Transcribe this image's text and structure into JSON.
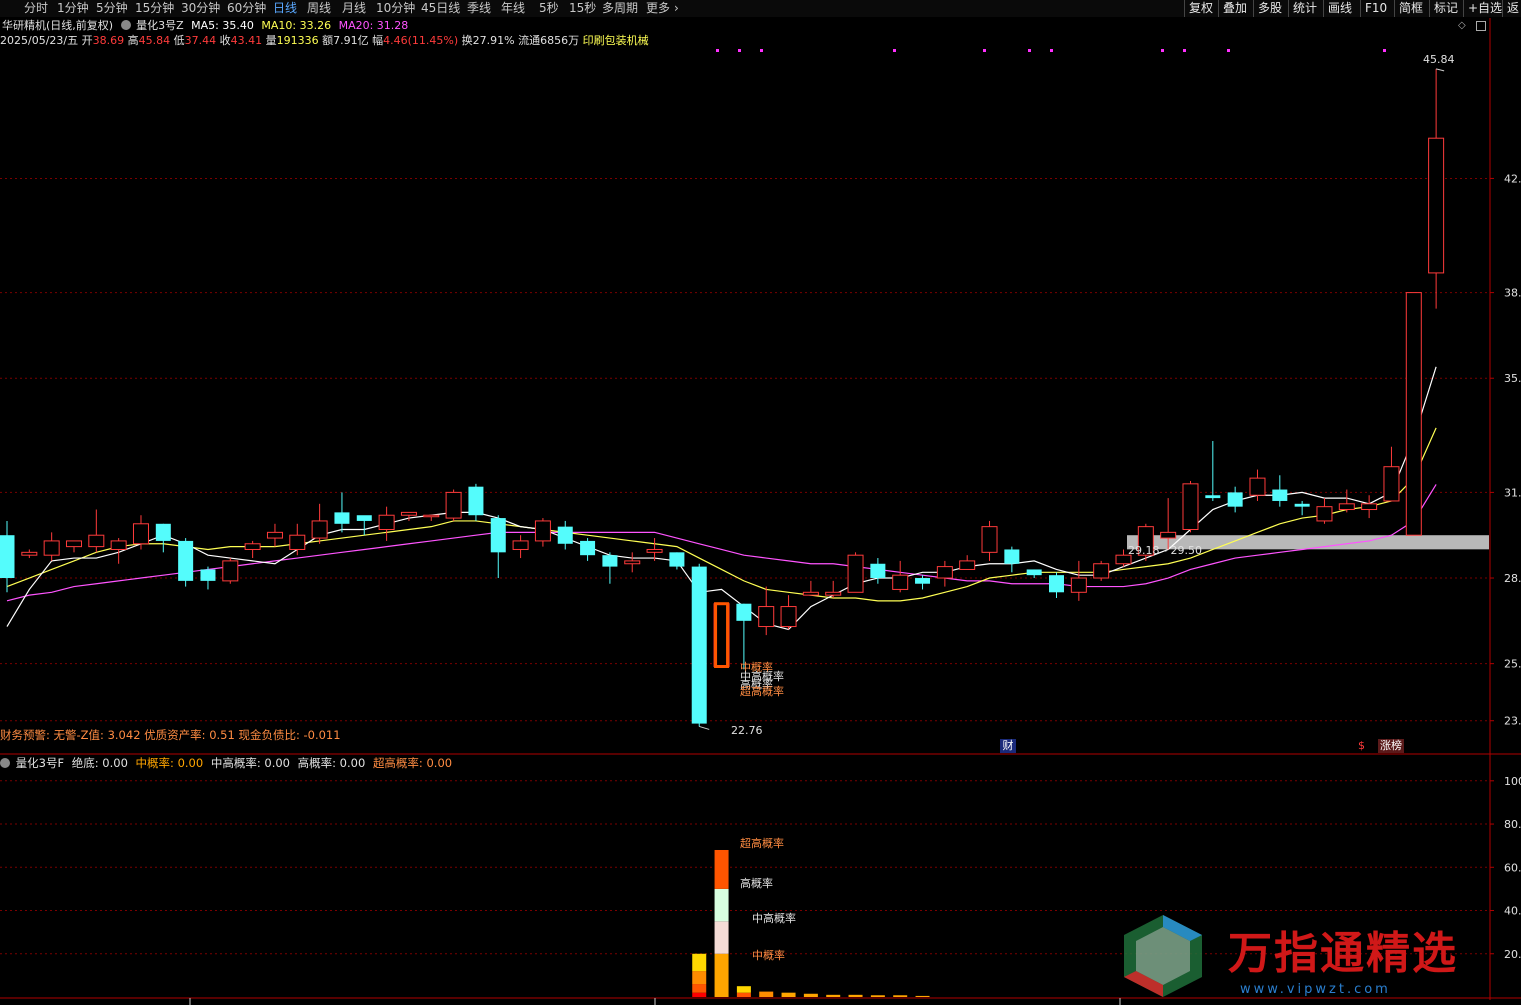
{
  "periods": [
    "分时",
    "1分钟",
    "5分钟",
    "15分钟",
    "30分钟",
    "60分钟",
    "日线",
    "周线",
    "月线",
    "10分钟",
    "45日线",
    "季线",
    "年线",
    "5秒",
    "15秒",
    "多周期",
    "更多"
  ],
  "active_period": "日线",
  "tools": [
    "复权",
    "叠加",
    "多股",
    "统计",
    "画线",
    "F10",
    "简框",
    "标记",
    "+自选",
    "返"
  ],
  "title": "华研精机(日线,前复权)",
  "indicator": "量化3号Z",
  "ma": {
    "ma5_label": "MA5: 35.40",
    "ma10_label": "MA10: 33.26",
    "ma20_label": "MA20: 31.28"
  },
  "info": {
    "date": "2025/05/23/五",
    "open_label": "开",
    "open": "38.69",
    "high_label": "高",
    "high": "45.84",
    "low_label": "低",
    "low": "37.44",
    "close_label": "收",
    "close": "43.41",
    "vol_label": "量",
    "vol": "191336",
    "amt_label": "额",
    "amt": "7.91亿",
    "chg_label": "幅",
    "chg": "4.46(11.45%)",
    "turn": "换27.91%",
    "float": "流通6856万",
    "sector": "印刷包装机械"
  },
  "fin_warning": "财务预警: 无警-Z值: 3.042 优质资产率: 0.51 现金负债比: -0.011",
  "zone_label": "29.18 - 29.50",
  "max_label": "45.84",
  "min_label": "22.76",
  "main_labels": [
    "中概率",
    "中高概率",
    "高概率",
    "超高概率"
  ],
  "price_axis": [
    "42.",
    "38.",
    "35.",
    "31.",
    "28.",
    "25.",
    "23."
  ],
  "badges": {
    "cai": "财",
    "s": "$",
    "zhangting": "涨榜"
  },
  "sub": {
    "title": "量化3号F",
    "jd": "绝底: 0.00",
    "zgl": "中概率: 0.00",
    "zggl": "中高概率: 0.00",
    "ggl": "高概率: 0.00",
    "cggl": "超高概率: 0.00",
    "axis": [
      "100",
      "80.",
      "60.",
      "40.",
      "20."
    ],
    "bar_labels": [
      "超高概率",
      "高概率",
      "中高概率",
      "中概率"
    ]
  },
  "watermark": {
    "text": "万指通精选",
    "url": "www.vipwzt.com"
  },
  "colors": {
    "up": "#ff3b3b",
    "down": "#54fcfc",
    "ma5": "#ffffff",
    "ma10": "#ffff54",
    "ma20": "#ff54ff",
    "grid": "#7a0000",
    "axis": "#b00000"
  },
  "chart_data": {
    "type": "candlestick",
    "y_range": [
      22.5,
      46.5
    ],
    "candles": [
      [
        29.5,
        28.0,
        30.0,
        27.5
      ],
      [
        28.8,
        28.9,
        29.0,
        28.7
      ],
      [
        28.8,
        29.3,
        29.6,
        28.6
      ],
      [
        29.1,
        29.3,
        29.3,
        28.9
      ],
      [
        29.1,
        29.5,
        30.4,
        28.9
      ],
      [
        29.0,
        29.3,
        29.4,
        28.5
      ],
      [
        29.2,
        29.9,
        30.2,
        29.0
      ],
      [
        29.9,
        29.3,
        29.9,
        28.9
      ],
      [
        29.3,
        27.9,
        29.4,
        27.7
      ],
      [
        28.3,
        27.9,
        28.4,
        27.6
      ],
      [
        27.9,
        28.6,
        28.7,
        27.8
      ],
      [
        29.0,
        29.2,
        29.3,
        28.7
      ],
      [
        29.4,
        29.6,
        29.9,
        29.1
      ],
      [
        29.0,
        29.5,
        29.9,
        28.8
      ],
      [
        29.4,
        30.0,
        30.6,
        29.2
      ],
      [
        30.3,
        29.9,
        31.0,
        29.6
      ],
      [
        30.2,
        30.0,
        30.1,
        29.5
      ],
      [
        29.7,
        30.2,
        30.5,
        29.3
      ],
      [
        30.2,
        30.3,
        30.3,
        30.0
      ],
      [
        30.2,
        30.2,
        30.2,
        30.0
      ],
      [
        30.1,
        31.0,
        31.1,
        30.0
      ],
      [
        31.2,
        30.2,
        31.3,
        30.0
      ],
      [
        30.1,
        28.9,
        30.2,
        28.0
      ],
      [
        29.0,
        29.3,
        29.5,
        28.7
      ],
      [
        29.3,
        30.0,
        30.1,
        29.1
      ],
      [
        29.8,
        29.2,
        30.0,
        29.0
      ],
      [
        29.3,
        28.8,
        29.4,
        28.6
      ],
      [
        28.8,
        28.4,
        28.9,
        27.8
      ],
      [
        28.5,
        28.6,
        28.9,
        28.2
      ],
      [
        28.9,
        29.0,
        29.4,
        28.6
      ],
      [
        28.9,
        28.4,
        28.9,
        28.3
      ],
      [
        28.4,
        22.9,
        28.5,
        22.8
      ],
      [
        24.9,
        27.1,
        27.1,
        24.9
      ],
      [
        27.1,
        26.5,
        27.1,
        24.8
      ],
      [
        26.3,
        27.0,
        27.7,
        26.0
      ],
      [
        26.3,
        27.0,
        27.4,
        26.2
      ],
      [
        27.4,
        27.5,
        27.9,
        27.4
      ],
      [
        27.4,
        27.5,
        27.9,
        27.3
      ],
      [
        27.5,
        28.8,
        28.9,
        27.6
      ],
      [
        28.5,
        28.0,
        28.7,
        27.8
      ],
      [
        27.6,
        28.1,
        28.6,
        27.5
      ],
      [
        28.0,
        27.8,
        28.1,
        27.6
      ],
      [
        28.0,
        28.4,
        28.6,
        27.7
      ],
      [
        28.3,
        28.6,
        28.8,
        28.3
      ],
      [
        28.9,
        29.8,
        30.0,
        28.6
      ],
      [
        29.0,
        28.5,
        29.1,
        28.2
      ],
      [
        28.3,
        28.1,
        28.3,
        28.0
      ],
      [
        28.1,
        27.5,
        28.2,
        27.3
      ],
      [
        27.5,
        28.0,
        28.6,
        27.2
      ],
      [
        28.0,
        28.5,
        28.6,
        27.9
      ],
      [
        28.5,
        28.8,
        29.0,
        28.4
      ],
      [
        28.8,
        29.8,
        29.9,
        28.6
      ],
      [
        29.4,
        29.6,
        30.8,
        29.0
      ],
      [
        29.7,
        31.3,
        31.4,
        29.6
      ],
      [
        30.9,
        30.8,
        32.8,
        30.7
      ],
      [
        31.0,
        30.5,
        31.2,
        30.3
      ],
      [
        30.9,
        31.5,
        31.8,
        30.7
      ],
      [
        31.1,
        30.7,
        31.6,
        30.5
      ],
      [
        30.6,
        30.5,
        30.7,
        30.2
      ],
      [
        30.0,
        30.5,
        30.8,
        29.9
      ],
      [
        30.4,
        30.6,
        31.1,
        30.3
      ],
      [
        30.4,
        30.6,
        30.9,
        30.1
      ],
      [
        30.7,
        31.9,
        32.6,
        30.8
      ],
      [
        29.5,
        38.0,
        38.0,
        29.5
      ],
      [
        38.69,
        43.41,
        45.84,
        37.44
      ]
    ],
    "ma5": [
      26.3,
      27.6,
      28.6,
      28.7,
      28.7,
      28.9,
      29.2,
      29.5,
      29.2,
      28.8,
      28.7,
      28.6,
      28.5,
      29.0,
      29.5,
      29.7,
      29.7,
      29.9,
      30.1,
      30.2,
      30.3,
      30.3,
      30.1,
      29.8,
      29.7,
      29.4,
      29.1,
      28.8,
      28.7,
      28.7,
      28.6,
      27.5,
      27.6,
      27.0,
      26.4,
      26.2,
      27.0,
      27.4,
      27.8,
      28.0,
      28.0,
      28.2,
      28.2,
      28.4,
      28.5,
      28.5,
      28.6,
      28.3,
      28.1,
      28.1,
      28.4,
      28.7,
      29.0,
      29.7,
      30.4,
      30.7,
      30.9,
      30.9,
      31.0,
      30.8,
      30.8,
      30.6,
      31.0,
      32.9,
      35.4
    ],
    "ma10": [
      27.7,
      28.0,
      28.3,
      28.6,
      28.9,
      29.1,
      29.2,
      29.2,
      29.1,
      29.0,
      29.1,
      29.1,
      29.1,
      29.2,
      29.3,
      29.4,
      29.5,
      29.6,
      29.7,
      29.8,
      30.0,
      30.0,
      29.9,
      29.8,
      29.7,
      29.6,
      29.5,
      29.4,
      29.3,
      29.2,
      29.1,
      28.7,
      28.3,
      27.9,
      27.6,
      27.5,
      27.4,
      27.3,
      27.3,
      27.2,
      27.2,
      27.3,
      27.5,
      27.7,
      28.0,
      28.1,
      28.2,
      28.2,
      28.2,
      28.2,
      28.3,
      28.4,
      28.5,
      28.7,
      29.0,
      29.3,
      29.6,
      29.9,
      30.1,
      30.2,
      30.4,
      30.5,
      30.7,
      31.5,
      33.26
    ],
    "ma20": [
      27.2,
      27.4,
      27.5,
      27.7,
      27.8,
      27.9,
      28.0,
      28.1,
      28.2,
      28.3,
      28.4,
      28.5,
      28.6,
      28.7,
      28.8,
      28.9,
      29.0,
      29.1,
      29.2,
      29.3,
      29.4,
      29.5,
      29.6,
      29.6,
      29.6,
      29.6,
      29.6,
      29.6,
      29.6,
      29.6,
      29.4,
      29.2,
      29.0,
      28.8,
      28.7,
      28.6,
      28.5,
      28.5,
      28.4,
      28.3,
      28.2,
      28.1,
      28.0,
      27.9,
      27.9,
      27.8,
      27.8,
      27.8,
      27.7,
      27.7,
      27.7,
      27.8,
      28.0,
      28.3,
      28.5,
      28.7,
      28.8,
      28.9,
      29.0,
      29.1,
      29.2,
      29.3,
      29.5,
      30.0,
      31.28
    ],
    "sub_bars": [
      {
        "i": 31,
        "top": 20.0,
        "color": "#ffd700"
      },
      {
        "i": 32,
        "top": 70.0,
        "color": "#ff5500"
      },
      {
        "i": 33,
        "top": 5.0,
        "color": "#ffd700"
      },
      {
        "i": 34,
        "top": 2.5,
        "color": "#ff8c00"
      },
      {
        "i": 35,
        "top": 2.0,
        "color": "#ffa500"
      },
      {
        "i": 36,
        "top": 1.5,
        "color": "#ffa500"
      },
      {
        "i": 37,
        "top": 1.0,
        "color": "#ffa500"
      },
      {
        "i": 38,
        "top": 1.0,
        "color": "#ffa500"
      },
      {
        "i": 39,
        "top": 0.8,
        "color": "#ffa500"
      },
      {
        "i": 40,
        "top": 0.8,
        "color": "#ffa500"
      },
      {
        "i": 41,
        "top": 0.5,
        "color": "#ffa500"
      }
    ],
    "sub_y_range": [
      0,
      105
    ]
  }
}
